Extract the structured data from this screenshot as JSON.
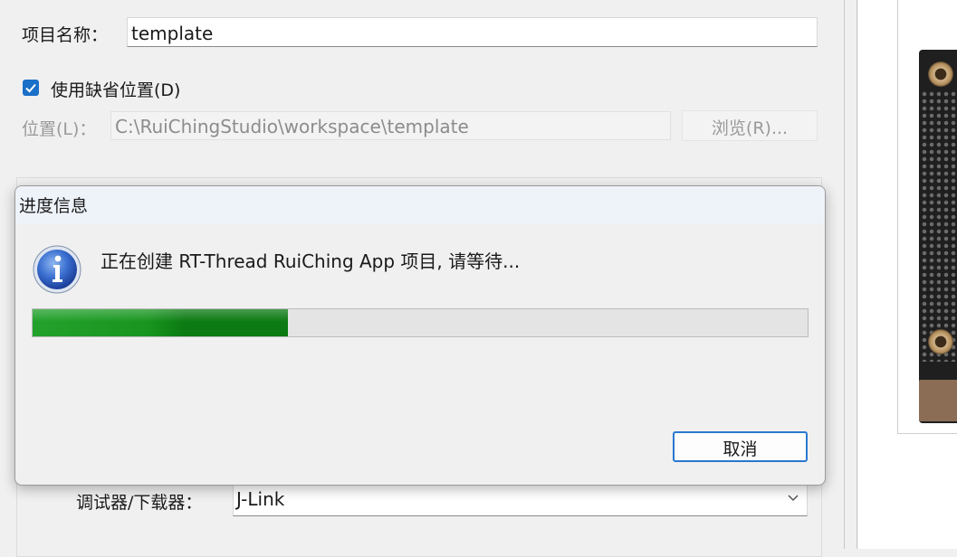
{
  "form": {
    "project_name_label": "项目名称：",
    "project_name_value": "template",
    "use_default_location_label": "使用缺省位置(D)",
    "use_default_location_checked": true,
    "location_label": "位置(L)：",
    "location_value": "C:\\RuiChingStudio\\workspace\\template",
    "browse_label": "浏览(R)...",
    "debugger_label": "调试器/下载器：",
    "debugger_value": "J-Link"
  },
  "dialog": {
    "title": "进度信息",
    "message": "正在创建 RT-Thread RuiChing App 项目, 请等待...",
    "progress_fraction": 0.33,
    "cancel_label": "取消",
    "icon": "info-icon"
  },
  "colors": {
    "accent": "#1a6fc9",
    "progress_green": "#0b7a12"
  }
}
